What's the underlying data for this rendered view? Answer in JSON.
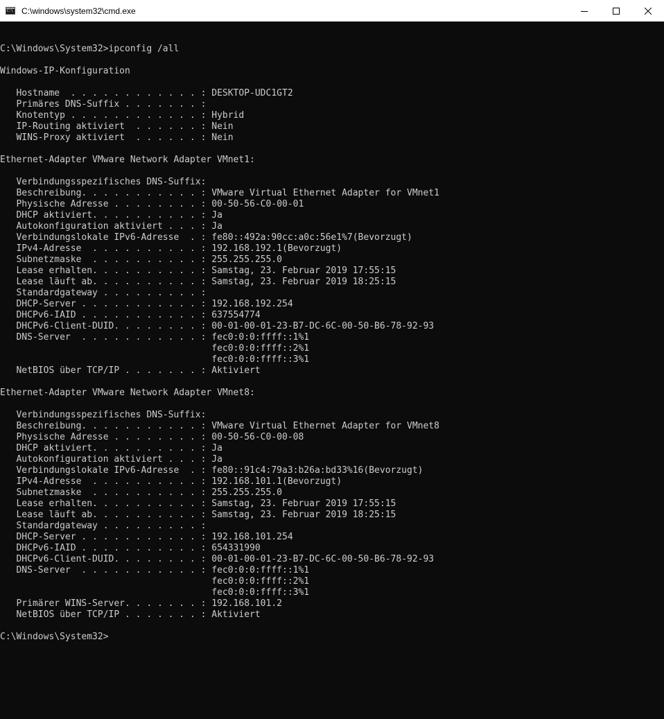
{
  "window": {
    "title": "C:\\windows\\system32\\cmd.exe",
    "icon": "cmd-app-icon",
    "controls": [
      "minimize-icon",
      "maximize-icon",
      "close-icon"
    ],
    "colors": {
      "titlebar_bg": "#ffffff",
      "console_bg": "#0c0c0c",
      "console_fg": "#cccccc"
    }
  },
  "console": {
    "lines": [
      "",
      "C:\\Windows\\System32>ipconfig /all",
      "",
      "Windows-IP-Konfiguration",
      "",
      "   Hostname  . . . . . . . . . . . . : DESKTOP-UDC1GT2",
      "   Primäres DNS-Suffix . . . . . . . :",
      "   Knotentyp . . . . . . . . . . . . : Hybrid",
      "   IP-Routing aktiviert  . . . . . . : Nein",
      "   WINS-Proxy aktiviert  . . . . . . : Nein",
      "",
      "Ethernet-Adapter VMware Network Adapter VMnet1:",
      "",
      "   Verbindungsspezifisches DNS-Suffix:",
      "   Beschreibung. . . . . . . . . . . : VMware Virtual Ethernet Adapter for VMnet1",
      "   Physische Adresse . . . . . . . . : 00-50-56-C0-00-01",
      "   DHCP aktiviert. . . . . . . . . . : Ja",
      "   Autokonfiguration aktiviert . . . : Ja",
      "   Verbindungslokale IPv6-Adresse  . : fe80::492a:90cc:a0c:56e1%7(Bevorzugt)",
      "   IPv4-Adresse  . . . . . . . . . . : 192.168.192.1(Bevorzugt)",
      "   Subnetzmaske  . . . . . . . . . . : 255.255.255.0",
      "   Lease erhalten. . . . . . . . . . : Samstag, 23. Februar 2019 17:55:15",
      "   Lease läuft ab. . . . . . . . . . : Samstag, 23. Februar 2019 18:25:15",
      "   Standardgateway . . . . . . . . . :",
      "   DHCP-Server . . . . . . . . . . . : 192.168.192.254",
      "   DHCPv6-IAID . . . . . . . . . . . : 637554774",
      "   DHCPv6-Client-DUID. . . . . . . . : 00-01-00-01-23-B7-DC-6C-00-50-B6-78-92-93",
      "   DNS-Server  . . . . . . . . . . . : fec0:0:0:ffff::1%1",
      "                                       fec0:0:0:ffff::2%1",
      "                                       fec0:0:0:ffff::3%1",
      "   NetBIOS über TCP/IP . . . . . . . : Aktiviert",
      "",
      "Ethernet-Adapter VMware Network Adapter VMnet8:",
      "",
      "   Verbindungsspezifisches DNS-Suffix:",
      "   Beschreibung. . . . . . . . . . . : VMware Virtual Ethernet Adapter for VMnet8",
      "   Physische Adresse . . . . . . . . : 00-50-56-C0-00-08",
      "   DHCP aktiviert. . . . . . . . . . : Ja",
      "   Autokonfiguration aktiviert . . . : Ja",
      "   Verbindungslokale IPv6-Adresse  . : fe80::91c4:79a3:b26a:bd33%16(Bevorzugt)",
      "   IPv4-Adresse  . . . . . . . . . . : 192.168.101.1(Bevorzugt)",
      "   Subnetzmaske  . . . . . . . . . . : 255.255.255.0",
      "   Lease erhalten. . . . . . . . . . : Samstag, 23. Februar 2019 17:55:15",
      "   Lease läuft ab. . . . . . . . . . : Samstag, 23. Februar 2019 18:25:15",
      "   Standardgateway . . . . . . . . . :",
      "   DHCP-Server . . . . . . . . . . . : 192.168.101.254",
      "   DHCPv6-IAID . . . . . . . . . . . : 654331990",
      "   DHCPv6-Client-DUID. . . . . . . . : 00-01-00-01-23-B7-DC-6C-00-50-B6-78-92-93",
      "   DNS-Server  . . . . . . . . . . . : fec0:0:0:ffff::1%1",
      "                                       fec0:0:0:ffff::2%1",
      "                                       fec0:0:0:ffff::3%1",
      "   Primärer WINS-Server. . . . . . . : 192.168.101.2",
      "   NetBIOS über TCP/IP . . . . . . . : Aktiviert",
      "",
      "C:\\Windows\\System32>"
    ]
  }
}
